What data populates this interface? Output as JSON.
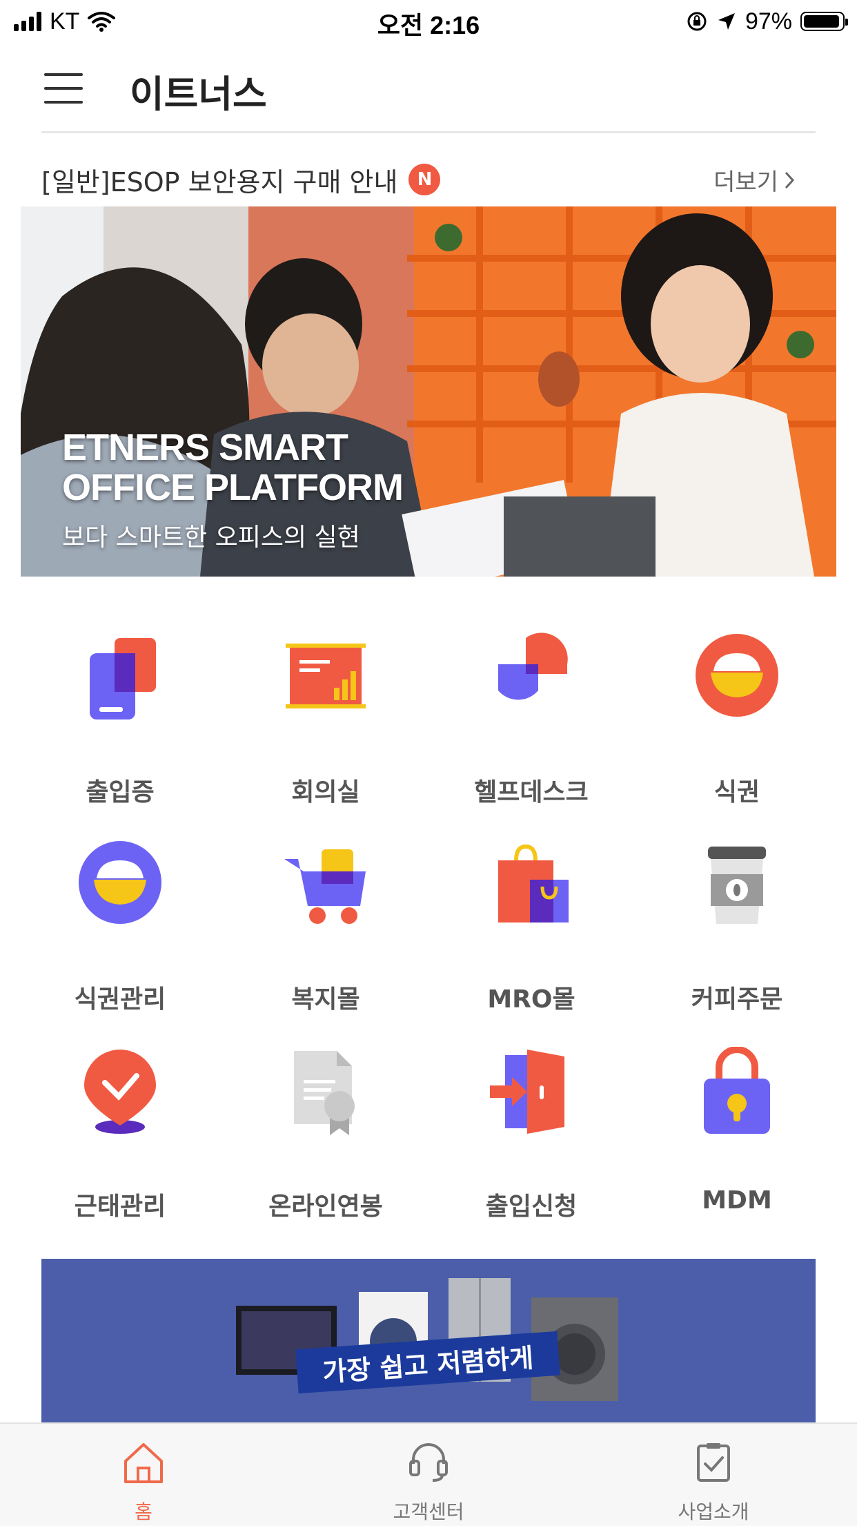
{
  "status_bar": {
    "carrier": "KT",
    "time": "오전 2:16",
    "battery": "97%"
  },
  "header": {
    "title": "이트너스"
  },
  "notice": {
    "text": "[일반]ESOP 보안용지 구매 안내",
    "badge": "N",
    "more": "더보기"
  },
  "banner": {
    "line1": "ETNERS SMART",
    "line2": "OFFICE PLATFORM",
    "subtitle": "보다 스마트한 오피스의 실현"
  },
  "menu": [
    {
      "label": "출입증",
      "icon": "access-card-icon"
    },
    {
      "label": "회의실",
      "icon": "meeting-room-icon"
    },
    {
      "label": "헬프데스크",
      "icon": "helpdesk-icon"
    },
    {
      "label": "식권",
      "icon": "meal-ticket-icon"
    },
    {
      "label": "식권관리",
      "icon": "meal-ticket-manage-icon"
    },
    {
      "label": "복지몰",
      "icon": "shopping-cart-icon"
    },
    {
      "label": "MRO몰",
      "icon": "shopping-bag-icon"
    },
    {
      "label": "커피주문",
      "icon": "coffee-cup-icon"
    },
    {
      "label": "근태관리",
      "icon": "attendance-icon"
    },
    {
      "label": "온라인연봉",
      "icon": "salary-document-icon"
    },
    {
      "label": "출입신청",
      "icon": "entry-request-icon"
    },
    {
      "label": "MDM",
      "icon": "lock-icon"
    }
  ],
  "ad": {
    "tagline": "가장 쉽고 저렴하게"
  },
  "tabbar": [
    {
      "label": "홈",
      "icon": "home-icon",
      "active": true
    },
    {
      "label": "고객센터",
      "icon": "headset-icon",
      "active": false
    },
    {
      "label": "사업소개",
      "icon": "checklist-icon",
      "active": false
    }
  ],
  "colors": {
    "accent": "#f15a42",
    "purple": "#6c63f5",
    "yellow": "#f5c518",
    "ad_bg": "#4c5ea9"
  }
}
